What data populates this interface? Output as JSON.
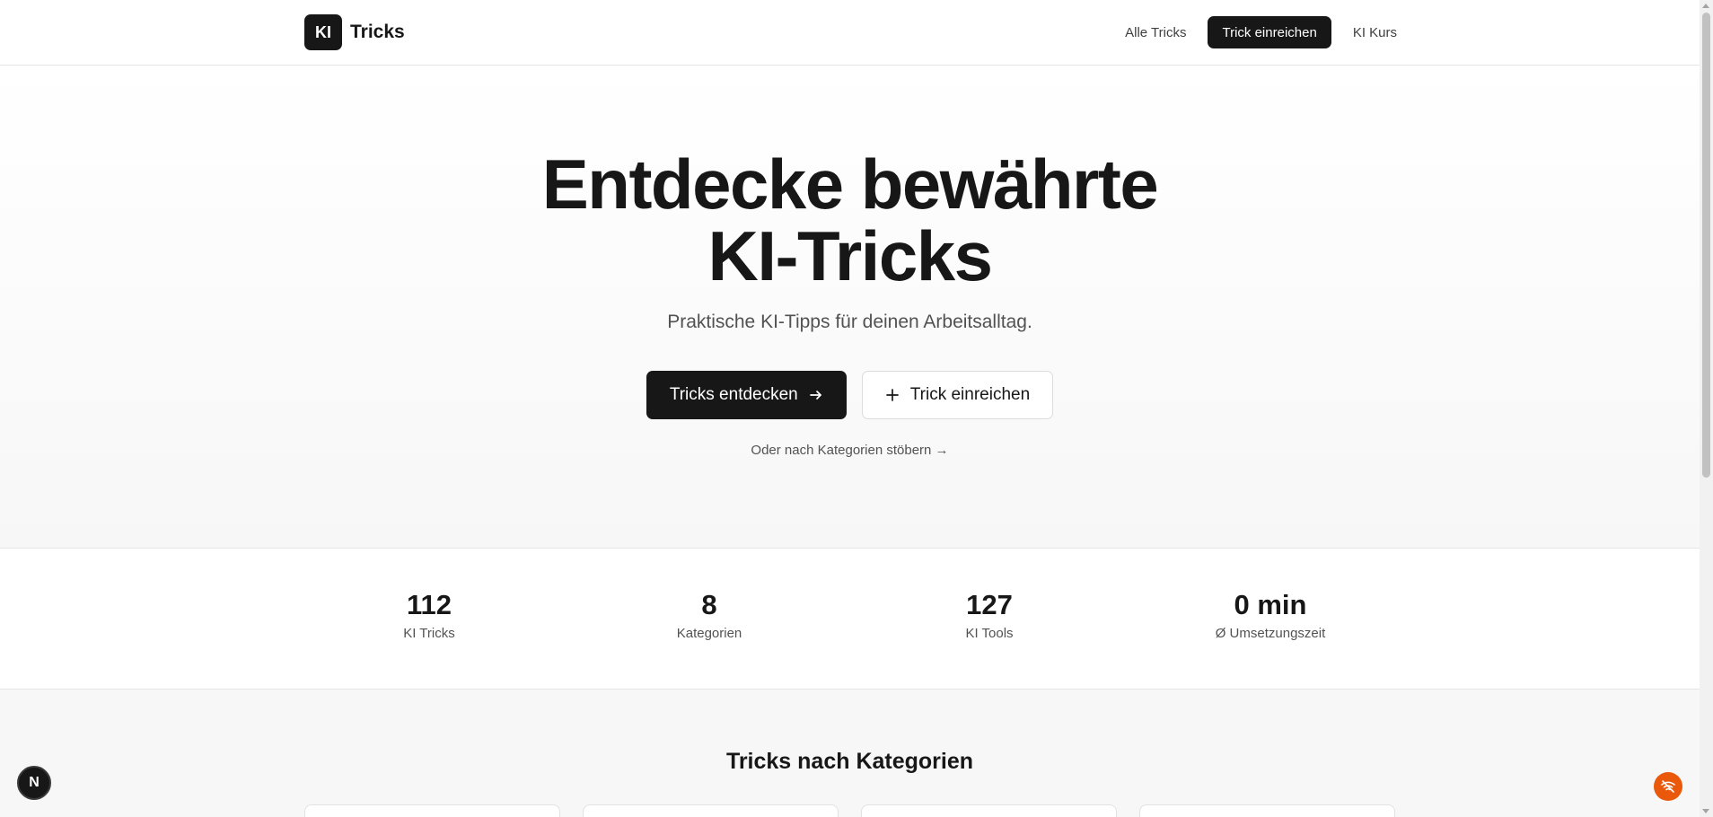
{
  "header": {
    "logo_badge": "KI",
    "logo_text": "Tricks",
    "nav": {
      "all_tricks": "Alle Tricks",
      "submit_trick": "Trick einreichen",
      "ki_course": "KI Kurs"
    }
  },
  "hero": {
    "title_line1": "Entdecke bewährte",
    "title_line2": "KI-Tricks",
    "subtitle": "Praktische KI-Tipps für deinen Arbeitsalltag.",
    "primary_button": "Tricks entdecken",
    "secondary_button": "Trick einreichen",
    "category_link": "Oder nach Kategorien stöbern →"
  },
  "stats": [
    {
      "value": "112",
      "label": "KI Tricks"
    },
    {
      "value": "8",
      "label": "Kategorien"
    },
    {
      "value": "127",
      "label": "KI Tools"
    },
    {
      "value": "0 min",
      "label": "Ø Umsetzungszeit"
    }
  ],
  "categories": {
    "title": "Tricks nach Kategorien"
  },
  "floating": {
    "left_badge": "N",
    "left_icon": "nextjs-icon",
    "right_icon": "wifi-off-icon"
  },
  "colors": {
    "primary": "#171717",
    "accent_orange": "#ea580c",
    "muted_text": "#525252",
    "border": "#e5e5e5"
  }
}
